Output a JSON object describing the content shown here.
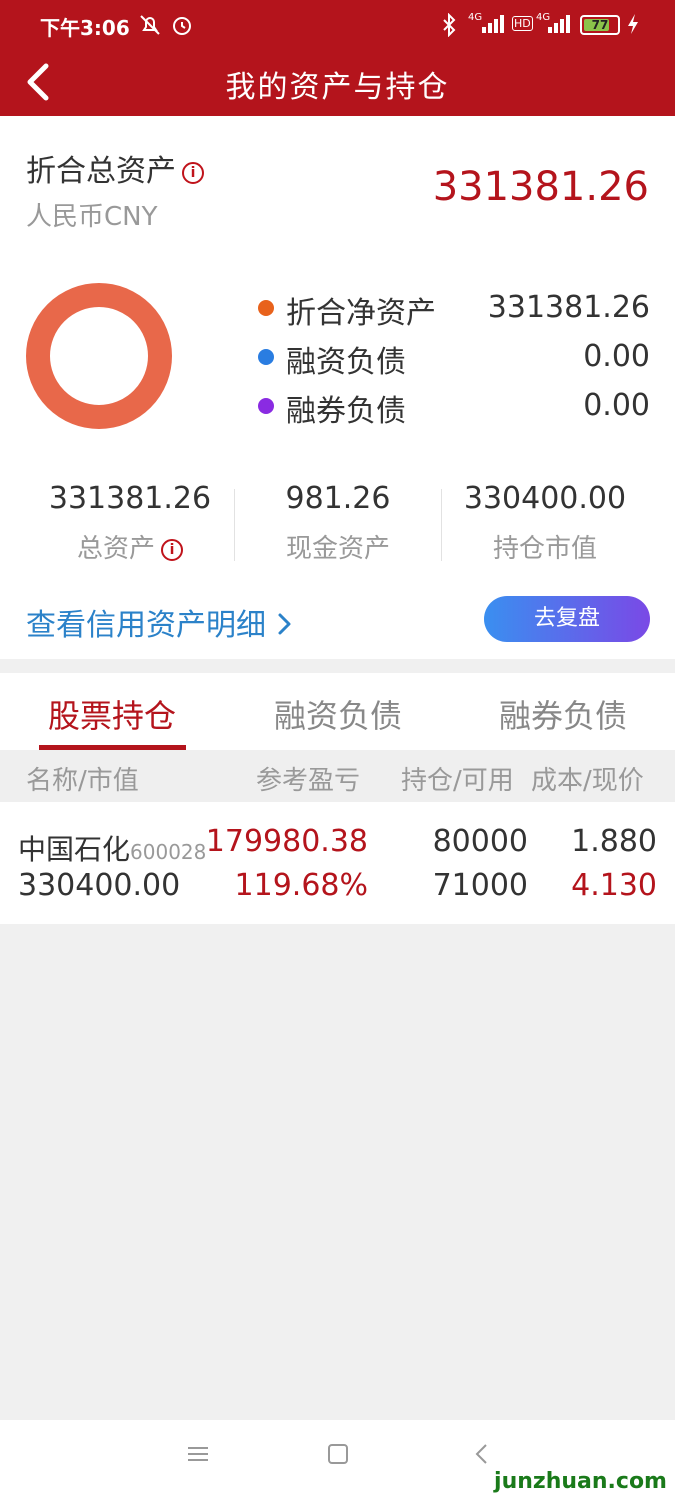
{
  "status_bar": {
    "time": "下午3:06",
    "battery": "77",
    "battery_level": 0.77,
    "network_label_1": "4G",
    "network_label_2": "HD",
    "network_label_3": "4G"
  },
  "header": {
    "title": "我的资产与持仓"
  },
  "summary": {
    "total_label": "折合总资产",
    "currency": "人民币CNY",
    "total_value": "331381.26",
    "info_glyph": "i"
  },
  "breakdown": [
    {
      "label": "折合净资产",
      "value": "331381.26",
      "color": "#e8621c"
    },
    {
      "label": "融资负债",
      "value": "0.00",
      "color": "#2a7de1"
    },
    {
      "label": "融券负债",
      "value": "0.00",
      "color": "#8a2be2"
    }
  ],
  "donut": {
    "color": "#e8684a"
  },
  "stats": [
    {
      "value": "331381.26",
      "label": "总资产"
    },
    {
      "value": "981.26",
      "label": "现金资产"
    },
    {
      "value": "330400.00",
      "label": "持仓市值"
    }
  ],
  "detail_link": "查看信用资产明细",
  "replay_button": "去复盘",
  "tabs": [
    "股票持仓",
    "融资负债",
    "融券负债"
  ],
  "table": {
    "headers": [
      "名称/市值",
      "参考盈亏",
      "持仓/可用",
      "成本/现价"
    ],
    "rows": [
      {
        "name": "中国石化",
        "code": "600028",
        "market_value": "330400.00",
        "pnl": "179980.38",
        "pnl_pct": "119.68%",
        "holding": "80000",
        "available": "71000",
        "cost": "1.880",
        "price": "4.130"
      }
    ]
  },
  "icons": {
    "back": "chevron-left-icon",
    "detail_arrow": "chevron-right-icon",
    "nav_menu": "menu-icon",
    "nav_home": "square-icon",
    "nav_back": "triangle-back-icon"
  },
  "colors": {
    "brand": "#b4141c",
    "link": "#2b82c9"
  },
  "watermark": "junzhuan.com"
}
